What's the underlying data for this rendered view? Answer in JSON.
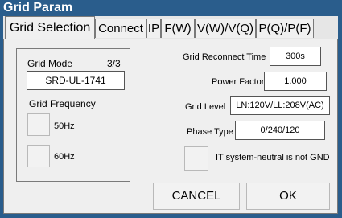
{
  "window": {
    "title": "Grid Param"
  },
  "tabs": [
    {
      "label": "Grid Selection"
    },
    {
      "label": "Connect"
    },
    {
      "label": "IP"
    },
    {
      "label": "F(W)"
    },
    {
      "label": "V(W)/V(Q)"
    },
    {
      "label": "P(Q)/P(F)"
    }
  ],
  "grid_mode": {
    "label": "Grid Mode",
    "page": "3/3",
    "value": "SRD-UL-1741"
  },
  "grid_frequency": {
    "label": "Grid Frequency",
    "options": [
      {
        "label": "50Hz"
      },
      {
        "label": "60Hz"
      }
    ]
  },
  "reconnect_time": {
    "label": "Grid Reconnect Time",
    "value": "300s"
  },
  "power_factor": {
    "label": "Power Factor",
    "value": "1.000"
  },
  "grid_level": {
    "label": "Grid Level",
    "value": "LN:120V/LL:208V(AC)"
  },
  "phase_type": {
    "label": "Phase Type",
    "value": "0/240/120"
  },
  "it_system": {
    "label": "IT system-neutral is not GND"
  },
  "buttons": {
    "cancel": "CANCEL",
    "ok": "OK"
  }
}
